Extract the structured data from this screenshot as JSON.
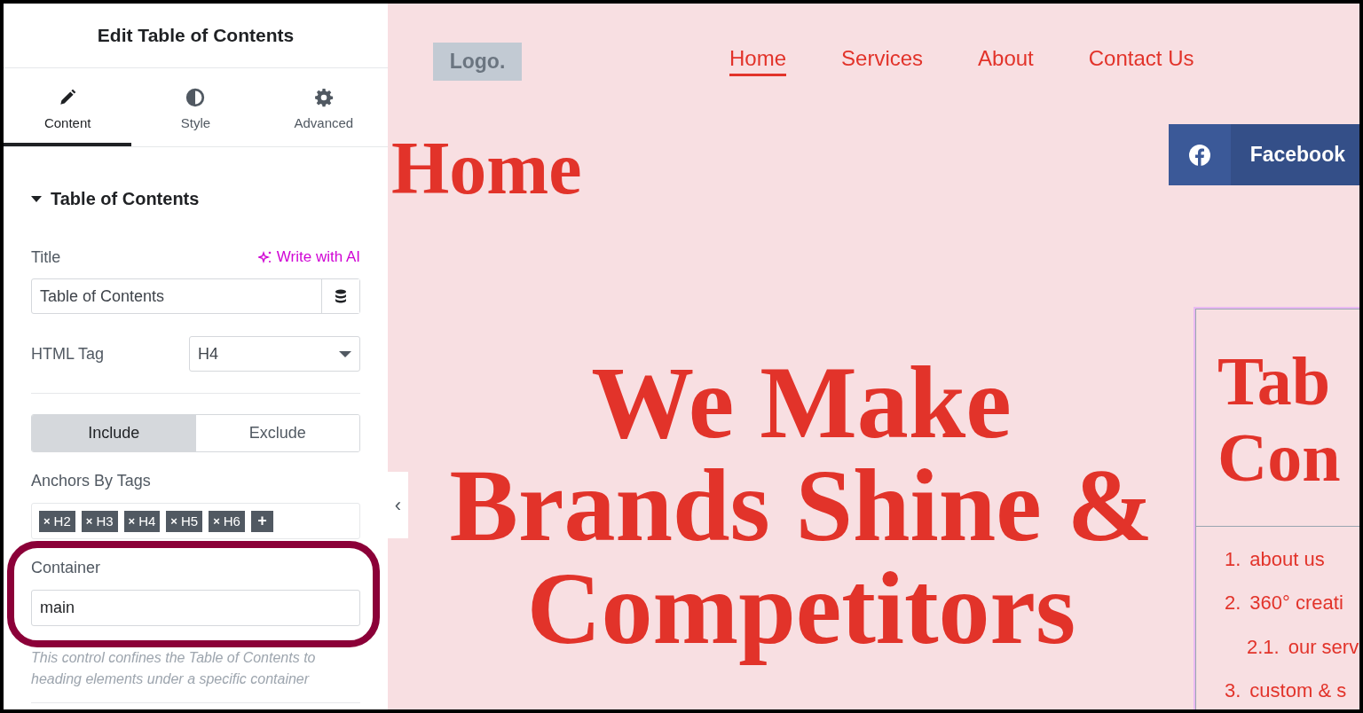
{
  "panel": {
    "title": "Edit Table of Contents",
    "tabs": [
      {
        "label": "Content",
        "selected": true
      },
      {
        "label": "Style",
        "selected": false
      },
      {
        "label": "Advanced",
        "selected": false
      }
    ],
    "section": {
      "title": "Table of Contents",
      "expanded": true
    },
    "title_field": {
      "label": "Title",
      "ai_link": "Write with AI",
      "value": "Table of Contents"
    },
    "html_tag": {
      "label": "HTML Tag",
      "value": "H4"
    },
    "mode_toggle": [
      {
        "label": "Include",
        "selected": true
      },
      {
        "label": "Exclude",
        "selected": false
      }
    ],
    "anchors": {
      "label": "Anchors By Tags",
      "tags": [
        "H2",
        "H3",
        "H4",
        "H5",
        "H6"
      ],
      "remove_glyph": "×",
      "add_glyph": "+"
    },
    "container_field": {
      "label": "Container",
      "value": "main",
      "help": "This control confines the Table of Contents to heading elements under a specific container",
      "highlighted": true
    },
    "collapse_glyph": "‹"
  },
  "preview": {
    "logo": "Logo.",
    "nav": [
      {
        "label": "Home",
        "selected": true
      },
      {
        "label": "Services",
        "selected": false
      },
      {
        "label": "About",
        "selected": false
      },
      {
        "label": "Contact Us",
        "selected": false
      }
    ],
    "page_title": "Home",
    "social_button": {
      "label": "Facebook"
    },
    "hero": "We Make Brands Shine & Competitors",
    "toc": {
      "title_lines": [
        "Tab",
        "Con"
      ],
      "items": [
        {
          "number": "1.",
          "text": "about us"
        },
        {
          "number": "2.",
          "text": "360° creati",
          "children": [
            {
              "number": "2.1.",
              "text": "our serv"
            }
          ]
        },
        {
          "number": "3.",
          "text": "custom & s"
        }
      ]
    }
  }
}
